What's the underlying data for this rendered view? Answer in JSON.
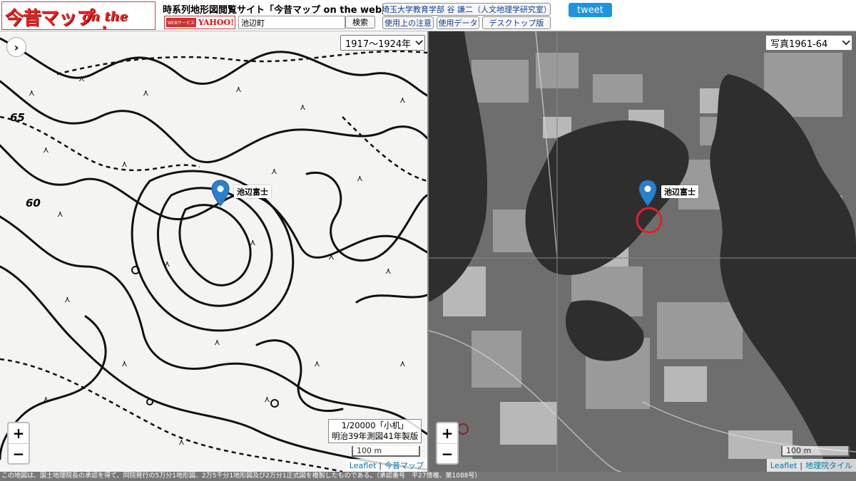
{
  "header": {
    "logo_main": "今昔マップ",
    "logo_sub": "on the web",
    "site_title": "時系列地形図閲覧サイト「今昔マップ on the web」",
    "yahoo_badge_small": "WEBサービス",
    "yahoo_badge_brand": "YAHOO!",
    "search_value": "池辺町",
    "search_button": "検索",
    "univ_button": "埼玉大学教育学部 谷 謙二（人文地理学研究室）",
    "notes_button": "使用上の注意",
    "data_button": "使用データ",
    "desktop_button": "デスクトップ版",
    "tweet_button": "tweet"
  },
  "left_map": {
    "period_select": "1917〜1924年",
    "marker_label": "池辺富士",
    "scale_info_line1": "1/20000「小机」",
    "scale_info_line2": "明治39年測図41年製版",
    "scale_label": "100 m",
    "zoom_in": "+",
    "zoom_out": "−",
    "toggle": "›",
    "attrib_leaflet": "Leaflet",
    "attrib_source": "今昔マップ",
    "contour_labels": [
      "65",
      "60"
    ]
  },
  "right_map": {
    "period_select": "写真1961-64",
    "marker_label": "池辺富士",
    "scale_label": "100 m",
    "zoom_in": "+",
    "zoom_out": "−",
    "attrib_leaflet": "Leaflet",
    "attrib_source": "地理院タイル"
  },
  "footer": {
    "text": "この地図は、国土地理院長の承認を得て、同院発行の5万分1地形図、2万5千分1地形図及び2万分1正式図を複製したものである。（承認番号　平27情複、第1088号）"
  },
  "colors": {
    "marker_blue": "#2a81cb",
    "highlight_red": "#e0202a",
    "tweet_blue": "#1b95e0",
    "logo_red": "#e8241c"
  }
}
